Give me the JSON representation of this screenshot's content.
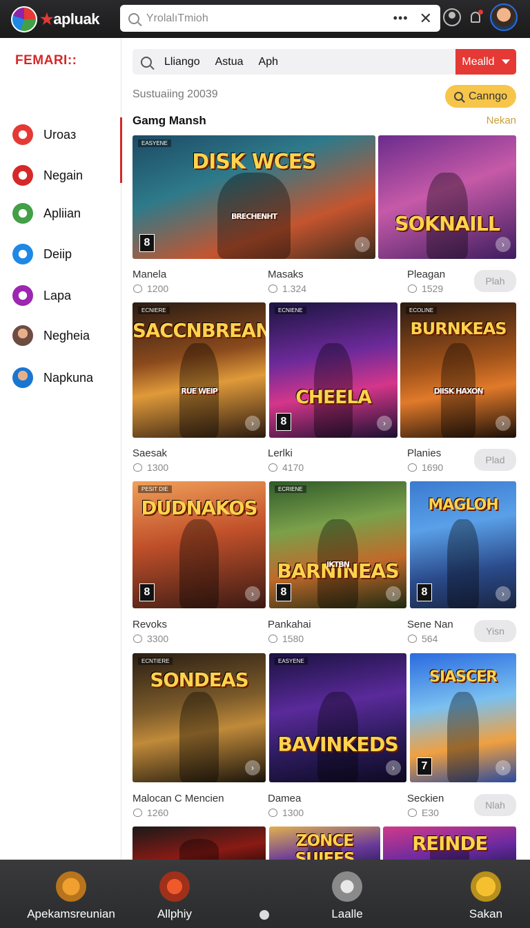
{
  "header": {
    "app_name": "apluak",
    "app_name_star": "★",
    "search_placeholder": "YrolalıTmioh",
    "more_label": "•••",
    "close_label": "✕"
  },
  "sidebar": {
    "heading": "FEMARI::",
    "items": [
      {
        "label": "Uroaз",
        "icon": "target-icon",
        "color": "#e53935"
      },
      {
        "label": "Negain",
        "icon": "mail-icon",
        "color": "#d62828"
      },
      {
        "label": "Apliian",
        "icon": "send-icon",
        "color": "#43a047"
      },
      {
        "label": "Deiip",
        "icon": "tag-icon",
        "color": "#1e88e5"
      },
      {
        "label": "Lapa",
        "icon": "spiral-icon",
        "color": "#9c27b0"
      },
      {
        "label": "Negheia",
        "icon": "avatar-icon",
        "color": "#6d4c41"
      },
      {
        "label": "Napkuna",
        "icon": "avatar-icon",
        "color": "#1976d2"
      }
    ]
  },
  "filter": {
    "chips": [
      "Lliango",
      "Astua",
      "Aph"
    ],
    "select_label": "Mealld"
  },
  "subtitle": "Sustuaiing 20039",
  "cta_label": "Canngo",
  "section": {
    "title": "Gamg Mansh",
    "link": "Nekan"
  },
  "games": [
    {
      "art_title": "DISK WCES",
      "art_subtitle": "BRECHENHT",
      "tag": "EASYENE",
      "badge": "8",
      "name": "Manela",
      "likes": "1200",
      "action": ""
    },
    {
      "art_title": "SOKNAILL",
      "art_subtitle": "",
      "tag": "",
      "badge": "",
      "name": "Masaks",
      "likes": "1.324",
      "action": ""
    },
    {
      "art_title": "",
      "art_subtitle": "",
      "tag": "",
      "badge": "",
      "name": "Pleagan",
      "likes": "1529",
      "action": "Plah"
    },
    {
      "art_title": "SACCNBREAN",
      "art_subtitle": "RUE WEIP",
      "tag": "ECNIERE",
      "badge": "",
      "name": "Saesak",
      "likes": "1300",
      "action": ""
    },
    {
      "art_title": "CHEELA",
      "art_subtitle": "",
      "tag": "ECNIENE",
      "badge": "8",
      "name": "Lerlki",
      "likes": "4170",
      "action": ""
    },
    {
      "art_title": "BURNKEAS",
      "art_subtitle": "DIISK HAXON",
      "tag": "ECOLINE",
      "badge": "",
      "name": "Planies",
      "likes": "1690",
      "action": "Plad"
    },
    {
      "art_title": "DUDNAKOS",
      "art_subtitle": "",
      "tag": "PESIT DIE",
      "badge": "8",
      "name": "Revoks",
      "likes": "3300",
      "action": ""
    },
    {
      "art_title": "BARNINEAS",
      "art_subtitle": "IKTBN",
      "tag": "ECRIENE",
      "badge": "8",
      "name": "Pankahai",
      "likes": "1580",
      "action": ""
    },
    {
      "art_title": "MAGLOH",
      "art_subtitle": "",
      "tag": "",
      "badge": "8",
      "name": "Sene Nan",
      "likes": "564",
      "action": "Yisn"
    },
    {
      "art_title": "SONDEAS",
      "art_subtitle": "",
      "tag": "ECNTIERE",
      "badge": "",
      "name": "Malocan C Mencien",
      "likes": "1260",
      "action": ""
    },
    {
      "art_title": "BAVINKEDS",
      "art_subtitle": "",
      "tag": "EASYENE",
      "badge": "",
      "name": "Damea",
      "likes": "1300",
      "action": ""
    },
    {
      "art_title": "SIASCER",
      "art_subtitle": "",
      "tag": "",
      "badge": "7",
      "name": "Seckien",
      "likes": "E30",
      "action": "Nlah"
    },
    {
      "art_title": "",
      "art_subtitle": "",
      "tag": "",
      "badge": "",
      "name": "",
      "likes": "",
      "action": ""
    },
    {
      "art_title": "ZONCE SUIEES",
      "art_subtitle": "",
      "tag": "",
      "badge": "",
      "name": "",
      "likes": "",
      "action": ""
    },
    {
      "art_title": "REINDE",
      "art_subtitle": "",
      "tag": "",
      "badge": "",
      "name": "",
      "likes": "",
      "action": ""
    }
  ],
  "bottom_nav": [
    {
      "label": "Apekamsreunian",
      "icon": "coin-icon"
    },
    {
      "label": "Allphiy",
      "icon": "flame-icon"
    },
    {
      "label": "Laalle",
      "icon": "person-icon"
    },
    {
      "label": "Sakan",
      "icon": "alert-icon"
    }
  ],
  "colors": {
    "accent": "#e53935",
    "cta": "#f6c54a",
    "topbar": "#1f1f21"
  }
}
